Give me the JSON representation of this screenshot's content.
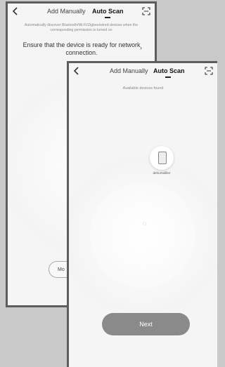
{
  "back_screen": {
    "tabs": {
      "manual": "Add Manually",
      "auto": "Auto Scan"
    },
    "hint": "Automatically discover Bluetooth/Wi-Fi/Zigbee/wired devices when the corresponding permission is turned on",
    "ensure": "Ensure that the device is ready for network connection.",
    "chevron": "›",
    "peek_button": "Mo"
  },
  "front_screen": {
    "tabs": {
      "manual": "Add Manually",
      "auto": "Auto Scan"
    },
    "found": "Available devices found",
    "device": {
      "label": "dehumidifier",
      "icon": "dehumidifier-icon"
    },
    "next_label": "Next"
  },
  "colors": {
    "background": "#c9c9c9",
    "screen": "#f5f5f5",
    "next_button": "#8a8a8a"
  }
}
